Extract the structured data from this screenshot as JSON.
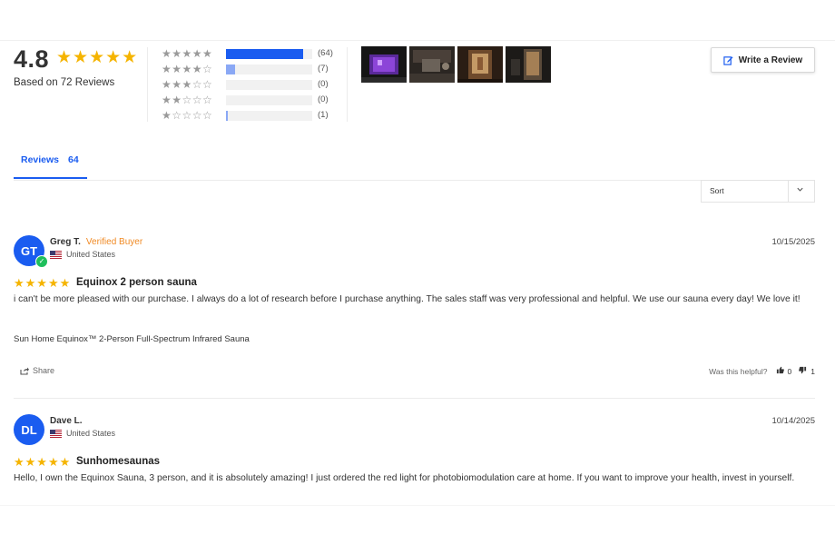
{
  "summary": {
    "average": "4.8",
    "stars": "★★★★★",
    "based_on": "Based on 72 Reviews"
  },
  "histogram": [
    {
      "stars": "★★★★★",
      "count": "(64)",
      "fraction": 0.89
    },
    {
      "stars": "★★★★☆",
      "count": "(7)",
      "fraction": 0.1
    },
    {
      "stars": "★★★☆☆",
      "count": "(0)",
      "fraction": 0
    },
    {
      "stars": "★★☆☆☆",
      "count": "(0)",
      "fraction": 0
    },
    {
      "stars": "★☆☆☆☆",
      "count": "(1)",
      "fraction": 0.014
    }
  ],
  "photos": [
    "photo-1",
    "photo-2",
    "photo-3",
    "photo-4"
  ],
  "write_review": {
    "label": "Write a Review",
    "icon": "pencil-square-icon"
  },
  "tabs": [
    {
      "label": "Reviews",
      "count": "64"
    }
  ],
  "sort": {
    "label": "Sort",
    "icon": "chevron-down-icon"
  },
  "reviews": [
    {
      "initials": "GT",
      "name": "Greg T.",
      "verified": "Verified Buyer",
      "location": "United States",
      "date": "10/15/2025",
      "stars": "★★★★★",
      "title": "Equinox 2 person sauna",
      "body": "i can't be more pleased with our purchase. I always do a lot of research before I purchase anything. The sales staff was very professional and helpful. We use our sauna every day! We love it!",
      "product": "Sun Home Equinox™ 2-Person Full-Spectrum Infrared Sauna",
      "share": "Share",
      "helpful_label": "Was this helpful?",
      "up": "0",
      "down": "1"
    },
    {
      "initials": "DL",
      "name": "Dave L.",
      "location": "United States",
      "date": "10/14/2025",
      "stars": "★★★★★",
      "title": "Sunhomesaunas",
      "body": "Hello, I own the Equinox Sauna, 3 person, and it is absolutely amazing! I just ordered the red light for photobiomodulation care at home. If you want to improve your health, invest in yourself."
    }
  ],
  "colors": {
    "accent": "#1a5cf0",
    "star": "#f5b400",
    "verified": "#f08a24",
    "verified_badge": "#1fbf5c"
  }
}
